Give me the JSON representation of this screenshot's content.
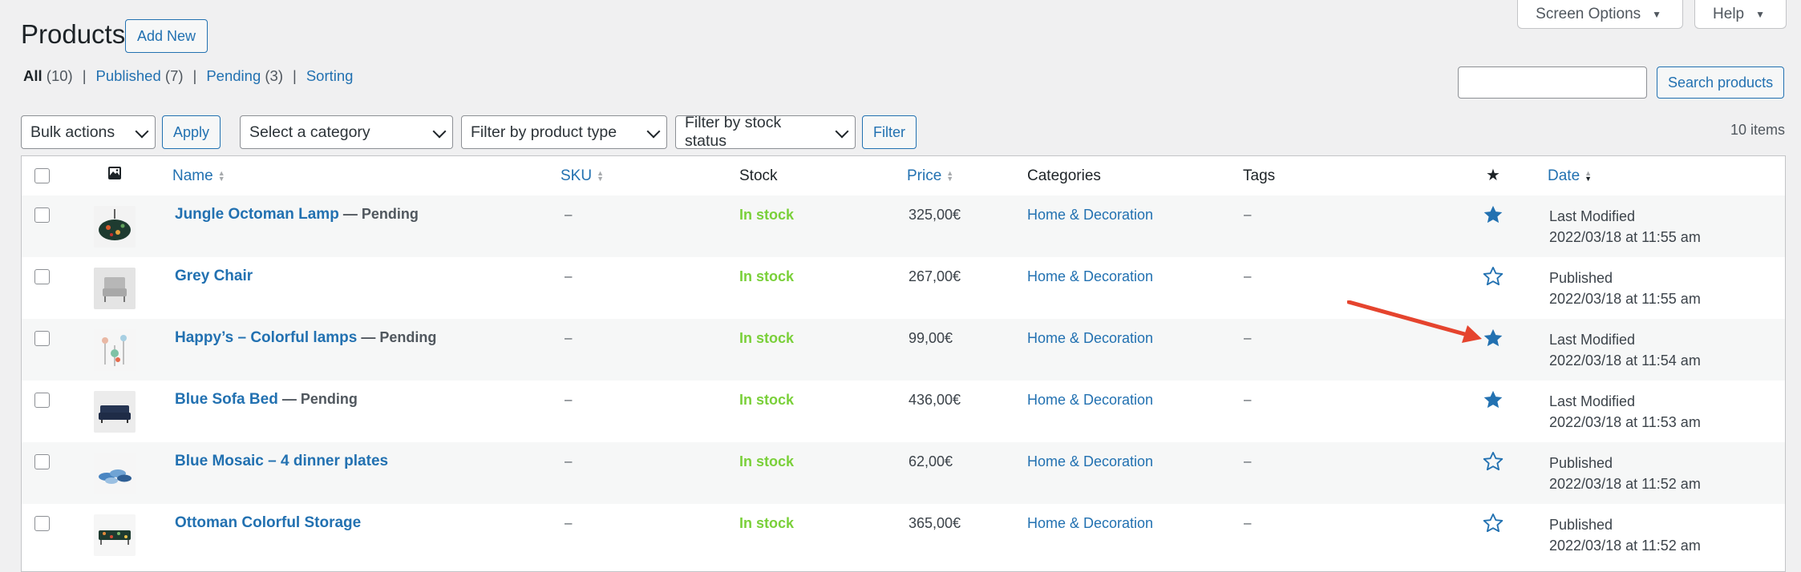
{
  "header": {
    "title": "Products",
    "add_new_label": "Add New",
    "screen_options_label": "Screen Options",
    "help_label": "Help"
  },
  "views": {
    "all": {
      "label": "All",
      "count": "(10)"
    },
    "published": {
      "label": "Published",
      "count": "(7)"
    },
    "pending": {
      "label": "Pending",
      "count": "(3)"
    },
    "sorting": {
      "label": "Sorting"
    },
    "separator": "|"
  },
  "search": {
    "placeholder": "",
    "button_label": "Search products"
  },
  "filters": {
    "bulk_actions": "Bulk actions",
    "apply_label": "Apply",
    "category": "Select a category",
    "product_type": "Filter by product type",
    "stock_status": "Filter by stock status",
    "filter_label": "Filter"
  },
  "items_count": "10 items",
  "columns": {
    "name": "Name",
    "sku": "SKU",
    "stock": "Stock",
    "price": "Price",
    "categories": "Categories",
    "tags": "Tags",
    "featured": "★",
    "date": "Date"
  },
  "rows": [
    {
      "name": "Jungle Octoman Lamp",
      "status": " — Pending",
      "sku": "–",
      "stock": "In stock",
      "price": "325,00€",
      "category": "Home & Decoration",
      "tags": "–",
      "featured": true,
      "date_label": "Last Modified",
      "date": "2022/03/18 at 11:55 am"
    },
    {
      "name": "Grey Chair",
      "status": "",
      "sku": "–",
      "stock": "In stock",
      "price": "267,00€",
      "category": "Home & Decoration",
      "tags": "–",
      "featured": false,
      "date_label": "Published",
      "date": "2022/03/18 at 11:55 am"
    },
    {
      "name": "Happy’s – Colorful lamps",
      "status": " — Pending",
      "sku": "–",
      "stock": "In stock",
      "price": "99,00€",
      "category": "Home & Decoration",
      "tags": "–",
      "featured": true,
      "date_label": "Last Modified",
      "date": "2022/03/18 at 11:54 am"
    },
    {
      "name": "Blue Sofa Bed",
      "status": " — Pending",
      "sku": "–",
      "stock": "In stock",
      "price": "436,00€",
      "category": "Home & Decoration",
      "tags": "–",
      "featured": true,
      "date_label": "Last Modified",
      "date": "2022/03/18 at 11:53 am"
    },
    {
      "name": "Blue Mosaic – 4 dinner plates",
      "status": "",
      "sku": "–",
      "stock": "In stock",
      "price": "62,00€",
      "category": "Home & Decoration",
      "tags": "–",
      "featured": false,
      "date_label": "Published",
      "date": "2022/03/18 at 11:52 am"
    },
    {
      "name": "Ottoman Colorful Storage",
      "status": "",
      "sku": "–",
      "stock": "In stock",
      "price": "365,00€",
      "category": "Home & Decoration",
      "tags": "–",
      "featured": false,
      "date_label": "Published",
      "date": "2022/03/18 at 11:52 am"
    }
  ],
  "colors": {
    "link": "#2271b1",
    "in_stock": "#7ad03a",
    "star": "#2271b1",
    "arrow": "#e5442e"
  }
}
